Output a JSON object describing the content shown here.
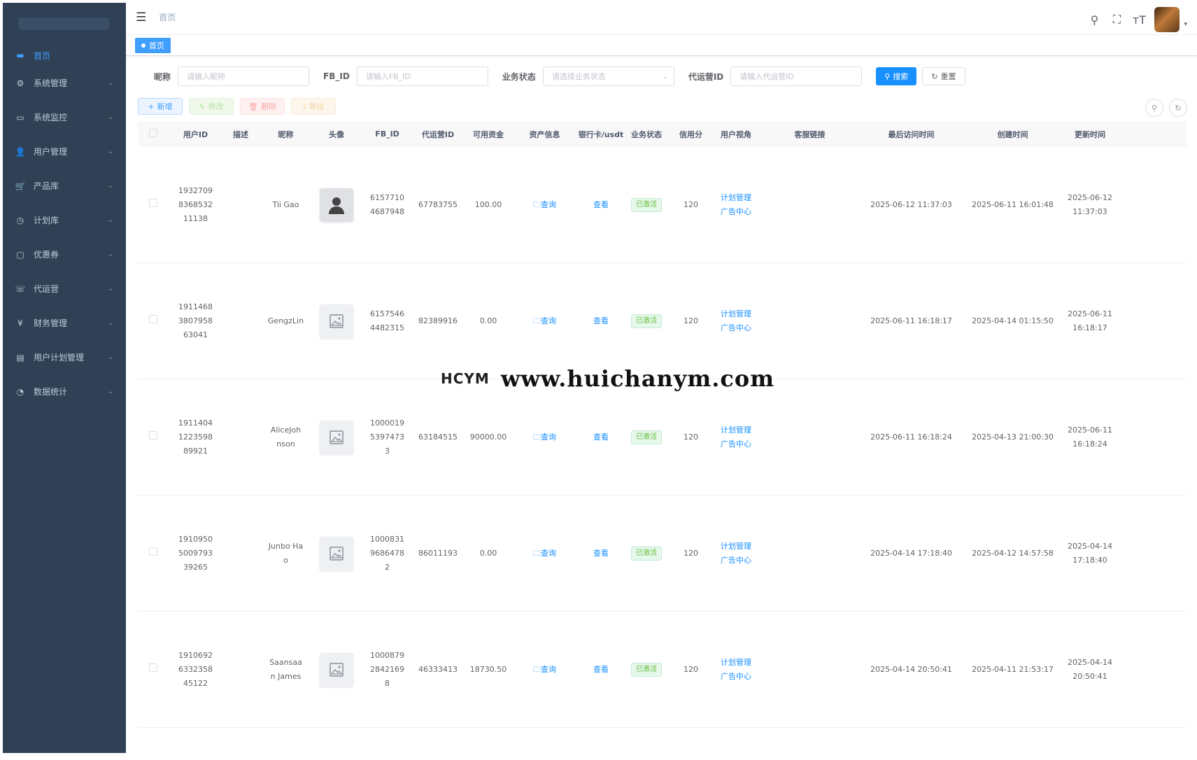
{
  "sidebar": {
    "home_label": "首页",
    "items": [
      {
        "label": "系统管理",
        "icon": "gear-icon",
        "glyph": "⚙"
      },
      {
        "label": "系统监控",
        "icon": "monitor-icon",
        "glyph": "▭"
      },
      {
        "label": "用户管理",
        "icon": "user-icon",
        "glyph": "👤"
      },
      {
        "label": "产品库",
        "icon": "cart-icon",
        "glyph": "🛒"
      },
      {
        "label": "计划库",
        "icon": "clock-icon",
        "glyph": "◷"
      },
      {
        "label": "优惠券",
        "icon": "coupon-icon",
        "glyph": "▢"
      },
      {
        "label": "代运营",
        "icon": "phone-icon",
        "glyph": "☏"
      },
      {
        "label": "财务管理",
        "icon": "yen-icon",
        "glyph": "¥"
      },
      {
        "label": "用户计划管理",
        "icon": "table-icon",
        "glyph": "▤"
      },
      {
        "label": "数据统计",
        "icon": "dashboard-icon",
        "glyph": "◔"
      }
    ]
  },
  "navbar": {
    "breadcrumb": "首页"
  },
  "tags": {
    "active": "首页"
  },
  "search": {
    "nickname_label": "昵称",
    "nickname_placeholder": "请输入昵称",
    "fbid_label": "FB_ID",
    "fbid_placeholder": "请输入FB_ID",
    "status_label": "业务状态",
    "status_placeholder": "请选择业务状态",
    "agent_label": "代运营ID",
    "agent_placeholder": "请输入代运营ID",
    "search_btn": "搜索",
    "reset_btn": "重置"
  },
  "toolbar": {
    "add": "新增",
    "edit": "修改",
    "delete": "删除",
    "export": "导出"
  },
  "table": {
    "headers": [
      "用户ID",
      "描述",
      "昵称",
      "头像",
      "FB_ID",
      "代运营ID",
      "可用资金",
      "资产信息",
      "银行卡/usdt",
      "业务状态",
      "信用分",
      "用户视角",
      "客服链接",
      "最后访问时间",
      "创建时间",
      "更新时间"
    ],
    "asset_link": "查询",
    "bank_link": "查看",
    "plan_link": "计划管理",
    "ad_link": "广告中心",
    "rows": [
      {
        "uid": [
          "1932709",
          "8368532",
          "11138"
        ],
        "desc": "",
        "nick": [
          "Tii Gao"
        ],
        "avatar": "user",
        "fbid": [
          "6157710",
          "4687948"
        ],
        "agent": "67783755",
        "funds": "100.00",
        "status": "已激活",
        "credit": "120",
        "last": "2025-06-12 11:37:03",
        "created": "2025-06-11 16:01:48",
        "updated": "2025-06-12 11:37:03"
      },
      {
        "uid": [
          "1911468",
          "3807958",
          "63041"
        ],
        "desc": "",
        "nick": [
          "GengzLin"
        ],
        "avatar": "image",
        "fbid": [
          "6157546",
          "4482315"
        ],
        "agent": "82389916",
        "funds": "0.00",
        "status": "已激活",
        "credit": "120",
        "last": "2025-06-11 16:18:17",
        "created": "2025-04-14 01:15:50",
        "updated": "2025-06-11 16:18:17"
      },
      {
        "uid": [
          "1911404",
          "1223598",
          "89921"
        ],
        "desc": "",
        "nick": [
          "AliceJoh",
          "nson"
        ],
        "avatar": "image",
        "fbid": [
          "1000019",
          "5397473",
          "3"
        ],
        "agent": "63184515",
        "funds": "90000.00",
        "status": "已激活",
        "credit": "120",
        "last": "2025-06-11 16:18:24",
        "created": "2025-04-13 21:00:30",
        "updated": "2025-06-11 16:18:24"
      },
      {
        "uid": [
          "1910950",
          "5009793",
          "39265"
        ],
        "desc": "",
        "nick": [
          "Junbo Ha",
          "o"
        ],
        "avatar": "image",
        "fbid": [
          "1000831",
          "9686478",
          "2"
        ],
        "agent": "86011193",
        "funds": "0.00",
        "status": "已激活",
        "credit": "120",
        "last": "2025-04-14 17:18:40",
        "created": "2025-04-12 14:57:58",
        "updated": "2025-04-14 17:18:40"
      },
      {
        "uid": [
          "1910692",
          "6332358",
          "45122"
        ],
        "desc": "",
        "nick": [
          "Saansaa",
          "n James"
        ],
        "avatar": "image",
        "fbid": [
          "1000879",
          "2842169",
          "8"
        ],
        "agent": "46333413",
        "funds": "18730.50",
        "status": "已激活",
        "credit": "120",
        "last": "2025-04-14 20:50:41",
        "created": "2025-04-11 21:53:17",
        "updated": "2025-04-14 20:50:41"
      }
    ]
  },
  "watermark": {
    "logo": "HCYM",
    "url": "www.huichanym.com"
  }
}
